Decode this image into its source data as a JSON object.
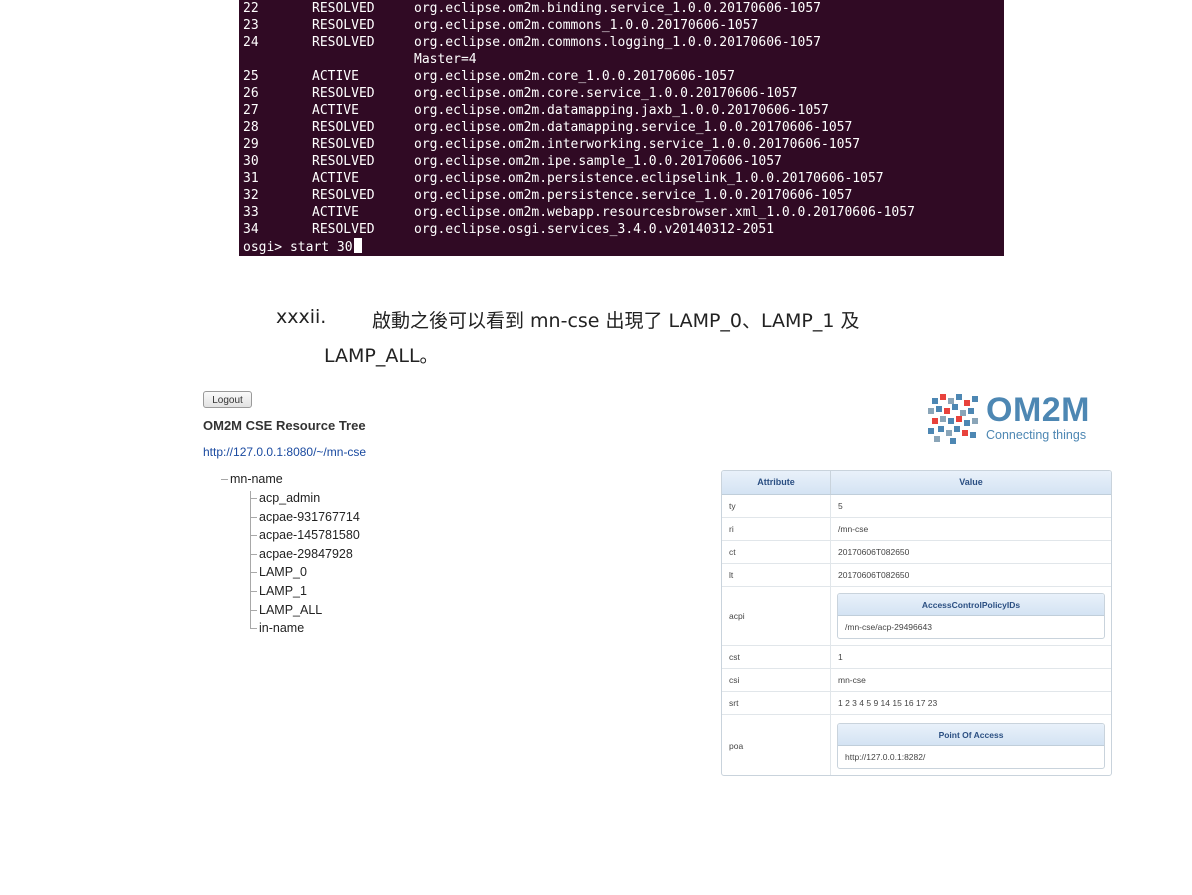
{
  "terminal": {
    "rows": [
      {
        "id": "22",
        "state": "RESOLVED",
        "name": "org.eclipse.om2m.binding.service_1.0.0.20170606-1057"
      },
      {
        "id": "23",
        "state": "RESOLVED",
        "name": "org.eclipse.om2m.commons_1.0.0.20170606-1057"
      },
      {
        "id": "24",
        "state": "RESOLVED",
        "name": "org.eclipse.om2m.commons.logging_1.0.0.20170606-1057"
      },
      {
        "id": "",
        "state": "",
        "name": "Master=4"
      },
      {
        "id": "25",
        "state": "ACTIVE",
        "name": "org.eclipse.om2m.core_1.0.0.20170606-1057"
      },
      {
        "id": "26",
        "state": "RESOLVED",
        "name": "org.eclipse.om2m.core.service_1.0.0.20170606-1057"
      },
      {
        "id": "27",
        "state": "ACTIVE",
        "name": "org.eclipse.om2m.datamapping.jaxb_1.0.0.20170606-1057"
      },
      {
        "id": "28",
        "state": "RESOLVED",
        "name": "org.eclipse.om2m.datamapping.service_1.0.0.20170606-1057"
      },
      {
        "id": "29",
        "state": "RESOLVED",
        "name": "org.eclipse.om2m.interworking.service_1.0.0.20170606-1057"
      },
      {
        "id": "30",
        "state": "RESOLVED",
        "name": "org.eclipse.om2m.ipe.sample_1.0.0.20170606-1057"
      },
      {
        "id": "31",
        "state": "ACTIVE",
        "name": "org.eclipse.om2m.persistence.eclipselink_1.0.0.20170606-1057"
      },
      {
        "id": "32",
        "state": "RESOLVED",
        "name": "org.eclipse.om2m.persistence.service_1.0.0.20170606-1057"
      },
      {
        "id": "33",
        "state": "ACTIVE",
        "name": "org.eclipse.om2m.webapp.resourcesbrowser.xml_1.0.0.20170606-1057"
      },
      {
        "id": "34",
        "state": "RESOLVED",
        "name": "org.eclipse.osgi.services_3.4.0.v20140312-2051"
      }
    ],
    "prompt": "osgi> start 30",
    "background": "#300a24"
  },
  "caption": {
    "number": "xxxii.",
    "line1": "啟動之後可以看到 mn-cse 出現了 LAMP_0、LAMP_1 及",
    "line2": "LAMP_ALL。"
  },
  "browser": {
    "logout_label": "Logout",
    "title": "OM2M CSE Resource Tree",
    "url": "http://127.0.0.1:8080/~/mn-cse",
    "root": "mn-name",
    "children": [
      "acp_admin",
      "acpae-931767714",
      "acpae-145781580",
      "acpae-29847928",
      "LAMP_0",
      "LAMP_1",
      "LAMP_ALL",
      "in-name"
    ],
    "logo": {
      "word": "OM2M",
      "tagline": "Connecting things",
      "color": "#4d87b3"
    },
    "table": {
      "header_attribute": "Attribute",
      "header_value": "Value",
      "rows": [
        {
          "key": "ty",
          "value": "5"
        },
        {
          "key": "ri",
          "value": "/mn-cse"
        },
        {
          "key": "ct",
          "value": "20170606T082650"
        },
        {
          "key": "lt",
          "value": "20170606T082650"
        }
      ],
      "acpi": {
        "key": "acpi",
        "header": "AccessControlPolicyIDs",
        "value": "/mn-cse/acp-29496643"
      },
      "rows2": [
        {
          "key": "cst",
          "value": "1"
        },
        {
          "key": "csi",
          "value": "mn-cse"
        },
        {
          "key": "srt",
          "value": "1 2 3 4 5 9 14 15 16 17 23"
        }
      ],
      "poa": {
        "key": "poa",
        "header": "Point Of Access",
        "value": "http://127.0.0.1:8282/"
      }
    }
  }
}
